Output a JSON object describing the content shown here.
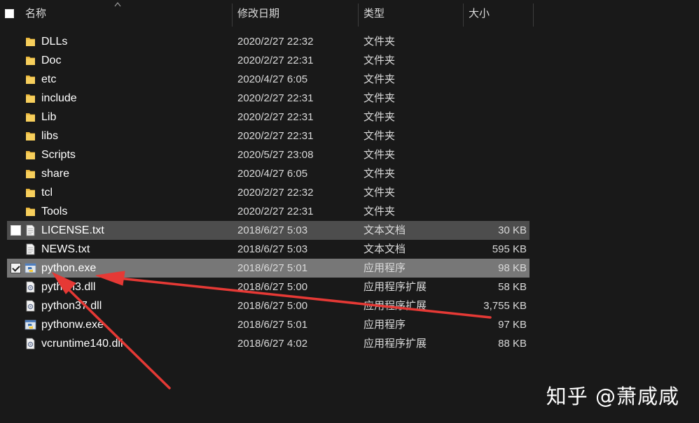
{
  "header": {
    "columns": {
      "name": "名称",
      "date": "修改日期",
      "type": "类型",
      "size": "大小"
    },
    "sort_column": "name",
    "sort_direction": "ascending"
  },
  "files": [
    {
      "name": "DLLs",
      "date": "2020/2/27 22:32",
      "type": "文件夹",
      "size": "",
      "icon": "folder-icon",
      "state": "normal",
      "checked": false
    },
    {
      "name": "Doc",
      "date": "2020/2/27 22:31",
      "type": "文件夹",
      "size": "",
      "icon": "folder-icon",
      "state": "normal",
      "checked": false
    },
    {
      "name": "etc",
      "date": "2020/4/27 6:05",
      "type": "文件夹",
      "size": "",
      "icon": "folder-icon",
      "state": "normal",
      "checked": false
    },
    {
      "name": "include",
      "date": "2020/2/27 22:31",
      "type": "文件夹",
      "size": "",
      "icon": "folder-icon",
      "state": "normal",
      "checked": false
    },
    {
      "name": "Lib",
      "date": "2020/2/27 22:31",
      "type": "文件夹",
      "size": "",
      "icon": "folder-icon",
      "state": "normal",
      "checked": false
    },
    {
      "name": "libs",
      "date": "2020/2/27 22:31",
      "type": "文件夹",
      "size": "",
      "icon": "folder-icon",
      "state": "normal",
      "checked": false
    },
    {
      "name": "Scripts",
      "date": "2020/5/27 23:08",
      "type": "文件夹",
      "size": "",
      "icon": "folder-icon",
      "state": "normal",
      "checked": false
    },
    {
      "name": "share",
      "date": "2020/4/27 6:05",
      "type": "文件夹",
      "size": "",
      "icon": "folder-icon",
      "state": "normal",
      "checked": false
    },
    {
      "name": "tcl",
      "date": "2020/2/27 22:32",
      "type": "文件夹",
      "size": "",
      "icon": "folder-icon",
      "state": "normal",
      "checked": false
    },
    {
      "name": "Tools",
      "date": "2020/2/27 22:31",
      "type": "文件夹",
      "size": "",
      "icon": "folder-icon",
      "state": "normal",
      "checked": false
    },
    {
      "name": "LICENSE.txt",
      "date": "2018/6/27 5:03",
      "type": "文本文档",
      "size": "30 KB",
      "icon": "text-file-icon",
      "state": "hover",
      "checked": false
    },
    {
      "name": "NEWS.txt",
      "date": "2018/6/27 5:03",
      "type": "文本文档",
      "size": "595 KB",
      "icon": "text-file-icon",
      "state": "normal",
      "checked": false
    },
    {
      "name": "python.exe",
      "date": "2018/6/27 5:01",
      "type": "应用程序",
      "size": "98 KB",
      "icon": "python-exe-icon",
      "state": "selected",
      "checked": true
    },
    {
      "name": "python3.dll",
      "date": "2018/6/27 5:00",
      "type": "应用程序扩展",
      "size": "58 KB",
      "icon": "dll-file-icon",
      "state": "normal",
      "checked": false
    },
    {
      "name": "python37.dll",
      "date": "2018/6/27 5:00",
      "type": "应用程序扩展",
      "size": "3,755 KB",
      "icon": "dll-file-icon",
      "state": "normal",
      "checked": false
    },
    {
      "name": "pythonw.exe",
      "date": "2018/6/27 5:01",
      "type": "应用程序",
      "size": "97 KB",
      "icon": "python-exe-icon",
      "state": "normal",
      "checked": false
    },
    {
      "name": "vcruntime140.dll",
      "date": "2018/6/27 4:02",
      "type": "应用程序扩展",
      "size": "88 KB",
      "icon": "dll-file-icon",
      "state": "normal",
      "checked": false
    }
  ],
  "colors": {
    "background": "#191919",
    "hover_row": "#4d4d4d",
    "selected_row": "#777777",
    "folder": "#f3c44b",
    "annotation_arrow": "#e53935"
  },
  "watermark": "知乎 @萧咸咸"
}
